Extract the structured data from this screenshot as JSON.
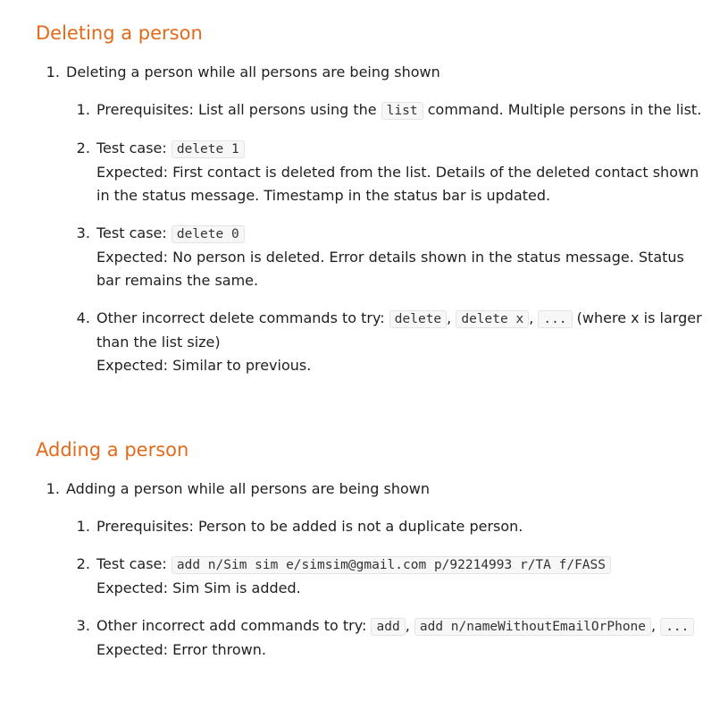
{
  "section1": {
    "title": "Deleting a person",
    "item": "Deleting a person while all persons are being shown",
    "steps": {
      "s1_pre": "Prerequisites: List all persons using the",
      "s1_code": "list",
      "s1_post": "command. Multiple persons in the list.",
      "s2_pre": "Test case:",
      "s2_code": "delete 1",
      "s2_expected": "Expected: First contact is deleted from the list. Details of the deleted contact shown in the status message. Timestamp in the status bar is updated.",
      "s3_pre": "Test case:",
      "s3_code": "delete 0",
      "s3_expected": "Expected: No person is deleted. Error details shown in the status message. Status bar remains the same.",
      "s4_pre": "Other incorrect delete commands to try:",
      "s4_code1": "delete",
      "s4_code2": "delete x",
      "s4_code3": "...",
      "s4_post": "(where x is larger than the list size)",
      "s4_expected": "Expected: Similar to previous."
    }
  },
  "section2": {
    "title": "Adding a person",
    "item": "Adding a person while all persons are being shown",
    "steps": {
      "s1_text": "Prerequisites: Person to be added is not a duplicate person.",
      "s2_pre": "Test case:",
      "s2_code": "add n/Sim sim e/simsim@gmail.com p/92214993 r/TA f/FASS",
      "s2_expected": "Expected: Sim Sim is added.",
      "s3_pre": "Other incorrect add commands to try:",
      "s3_code1": "add",
      "s3_code2": "add n/nameWithoutEmailOrPhone",
      "s3_code3": "...",
      "s3_expected": "Expected: Error thrown."
    }
  }
}
